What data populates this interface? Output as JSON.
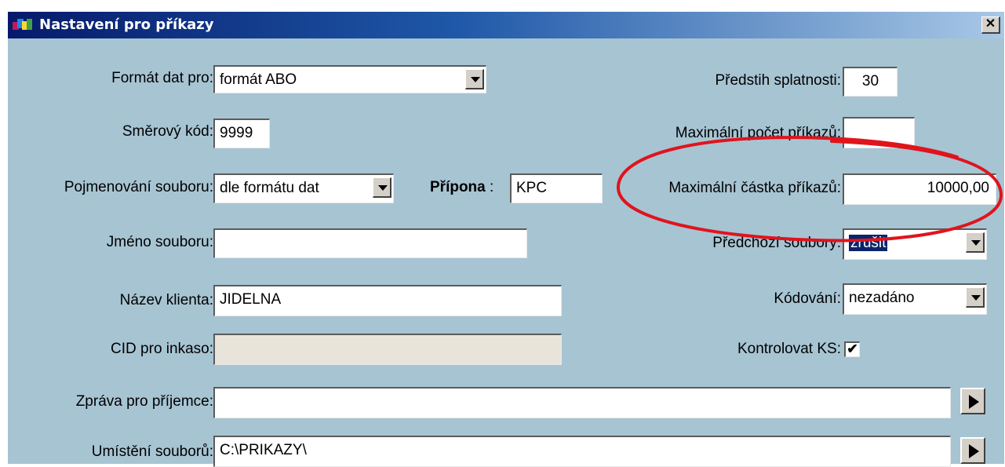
{
  "window": {
    "title": "Nastavení pro příkazy",
    "close_glyph": "✕"
  },
  "form": {
    "format_label": "Formát dat pro:",
    "format_value": "formát ABO",
    "routing_label": "Směrový kód:",
    "routing_value": "9999",
    "naming_label": "Pojmenování souboru:",
    "naming_value": "dle formátu dat",
    "extension_label": "Přípona",
    "extension_colon": ":",
    "extension_value": "KPC",
    "filename_label": "Jméno souboru:",
    "filename_value": "",
    "client_label": "Název klienta:",
    "client_value": "JIDELNA",
    "cid_label": "CID pro inkaso:",
    "cid_value": "",
    "message_label": "Zpráva pro příjemce:",
    "message_value": "",
    "location_label": "Umístění souborů:",
    "location_value": "C:\\PRIKAZY\\",
    "lead_label": "Předstih splatnosti:",
    "lead_value": "30",
    "max_count_label": "Maximální počet příkazů:",
    "max_count_value": "",
    "max_amount_label": "Maximální částka příkazů:",
    "max_amount_value": "10000,00",
    "previous_label": "Předchozí soubory:",
    "previous_value": "zrušit",
    "encoding_label": "Kódování:",
    "encoding_value": "nezadáno",
    "check_ks_label": "Kontrolovat KS:",
    "check_ks_checked": true,
    "check_glyph": "✔"
  },
  "icons": {
    "app": "app-icon",
    "dropdown": "chevron-down-icon",
    "play": "play-arrow-icon"
  },
  "colors": {
    "dialog_bg": "#a7c4d3",
    "title_start": "#061a6b",
    "title_end": "#a8c8e6",
    "selection": "#0a246a",
    "annotation_red": "#e0141c",
    "disabled_field": "#e8e4da"
  }
}
